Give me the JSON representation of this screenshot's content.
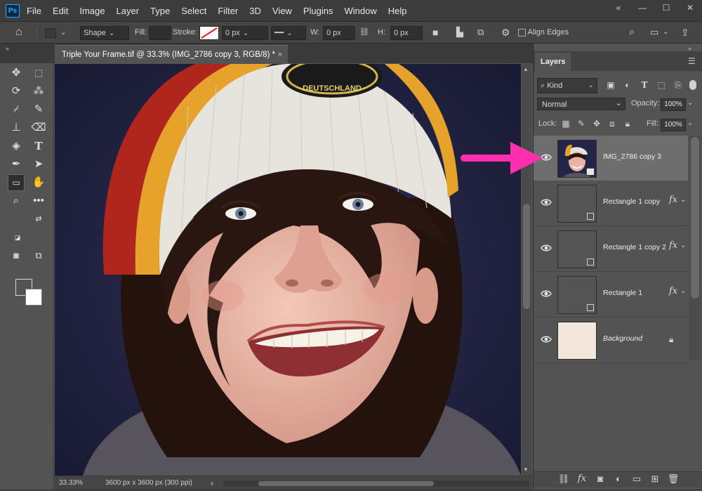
{
  "app": {
    "logo_text": "Ps"
  },
  "menu": {
    "items": [
      "File",
      "Edit",
      "Image",
      "Layer",
      "Type",
      "Select",
      "Filter",
      "3D",
      "View",
      "Plugins",
      "Window",
      "Help"
    ]
  },
  "window_controls": {
    "collapse": "«",
    "minimize": "—",
    "maximize": "☐",
    "close": "✕"
  },
  "options_bar": {
    "tool_mode": "Shape",
    "fill_label": "Fill:",
    "stroke_label": "Stroke:",
    "stroke_width": "0 px",
    "w_label": "W:",
    "w_value": "0 px",
    "h_label": "H:",
    "h_value": "0 px",
    "align_edges_label": "Align Edges"
  },
  "document_tab": {
    "title": "Triple Your Frame.tif @ 33.3% (IMG_2786 copy 3, RGB/8) *",
    "close": "×"
  },
  "canvas": {
    "hat_patch_text": "DEUTSCHLAND",
    "colors": {
      "background": "#1a1d3a",
      "hat": "#e6e4dc",
      "stripe_red": "#b0251c",
      "stripe_yellow": "#e6a22b",
      "hair": "#2a1610",
      "skin": "#e7b4a4",
      "shirt": "#5a5560"
    }
  },
  "status_bar": {
    "zoom": "33.33%",
    "doc_info": "3600 px x 3600 px (300 ppi)",
    "arrow": "›"
  },
  "layers_panel": {
    "tab_label": "Layers",
    "kind_label": "Kind",
    "blend_mode": "Normal",
    "opacity_label": "Opacity:",
    "opacity_value": "100%",
    "lock_label": "Lock:",
    "fill_label": "Fill:",
    "fill_value": "100%",
    "layers": [
      {
        "name": "IMG_2786 copy 3",
        "selected": true,
        "type": "smart-object"
      },
      {
        "name": "Rectangle 1 copy",
        "selected": false,
        "type": "shape",
        "fx": "fx"
      },
      {
        "name": "Rectangle 1 copy 2",
        "selected": false,
        "type": "shape",
        "fx": "fx"
      },
      {
        "name": "Rectangle 1",
        "selected": false,
        "type": "shape",
        "fx": "fx"
      },
      {
        "name": "Background",
        "selected": false,
        "type": "background",
        "locked": true
      }
    ]
  },
  "accent": {
    "pink_arrow": "#ff2fb0",
    "selection": "#6e6e6e"
  }
}
